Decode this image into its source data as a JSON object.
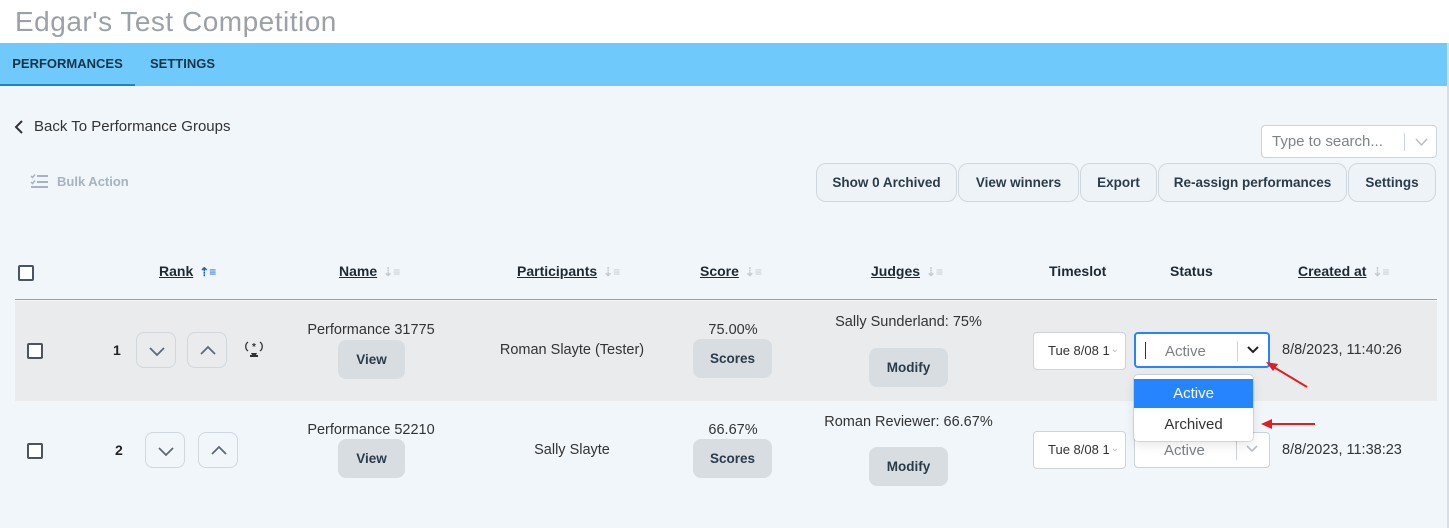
{
  "app": {
    "title": "Edgar's Test Competition"
  },
  "tabs": [
    {
      "label": "PERFORMANCES"
    },
    {
      "label": "SETTINGS"
    }
  ],
  "back_link": {
    "label": "Back To Performance Groups"
  },
  "search": {
    "placeholder": "Type to search..."
  },
  "bulk_action": {
    "label": "Bulk Action"
  },
  "toolbar": {
    "show_archived": "Show 0 Archived",
    "view_winners": "View winners",
    "export": "Export",
    "reassign": "Re-assign performances",
    "settings": "Settings"
  },
  "table": {
    "columns": {
      "rank": "Rank",
      "name": "Name",
      "participants": "Participants",
      "score": "Score",
      "judges": "Judges",
      "timeslot": "Timeslot",
      "status": "Status",
      "created_at": "Created at"
    },
    "rows": [
      {
        "rank": "1",
        "name": "Performance 31775",
        "view_label": "View",
        "participants": "Roman Slayte (Tester)",
        "score": "75.00%",
        "scores_label": "Scores",
        "judge": "Sally Sunderland: 75%",
        "modify_label": "Modify",
        "timeslot": "Tue 8/08 1",
        "status": "Active",
        "created_at": "8/8/2023, 11:40:26"
      },
      {
        "rank": "2",
        "name": "Performance 52210",
        "view_label": "View",
        "participants": "Sally Slayte",
        "score": "66.67%",
        "scores_label": "Scores",
        "judge": "Roman Reviewer: 66.67%",
        "modify_label": "Modify",
        "timeslot": "Tue 8/08 1",
        "status": "Active",
        "created_at": "8/8/2023, 11:38:23"
      }
    ]
  },
  "status_dropdown": {
    "options": [
      "Active",
      "Archived"
    ],
    "selected": "Active"
  },
  "colors": {
    "tab_bar": "#70c9fb",
    "page_bg": "#f1f6fa",
    "highlight_row": "#e9ebed",
    "focus_blue": "#2684ff",
    "annotation_red": "#e02020"
  }
}
